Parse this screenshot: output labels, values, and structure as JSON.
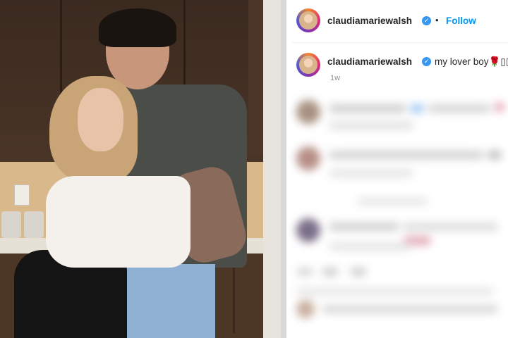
{
  "post": {
    "username": "claudiamariewalsh",
    "follow_label": "Follow",
    "separator": "•",
    "caption_text": "my lover boy",
    "caption_emoji": "🌹",
    "caption_boxes": "▯▯▯",
    "timestamp": "1w",
    "verified_mark": "✓"
  },
  "colors": {
    "follow_blue": "#0095f6",
    "verified_blue": "#3897f0"
  }
}
